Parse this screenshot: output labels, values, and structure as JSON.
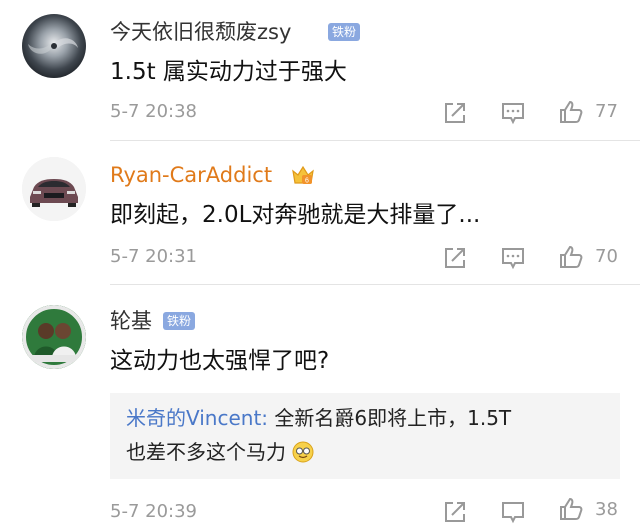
{
  "comments": [
    {
      "username": "今天依旧很颓废zsy",
      "badge": "铁粉",
      "text": "1.5t 属实动力过于强大",
      "time": "5-7 20:38",
      "likes": "77"
    },
    {
      "username": "Ryan-CarAddict",
      "text": "即刻起，2.0L对奔驰就是大排量了...",
      "time": "5-7 20:31",
      "likes": "70"
    },
    {
      "username": "轮基",
      "badge": "铁粉",
      "text": "这动力也太强悍了吧?",
      "reply": {
        "author": "米奇的Vincent:",
        "line1": " 全新名爵6即将上市，1.5T",
        "line2": "也差不多这个马力"
      },
      "time": "5-7 20:39",
      "likes": "38"
    }
  ],
  "icons": {
    "share": "share-icon",
    "comment": "comment-icon",
    "like": "thumbs-up-icon",
    "vip": "vip-crown-icon",
    "emoji": "grin-emoji-icon"
  },
  "colors": {
    "vip_name": "#e07a1a",
    "badge_bg": "#8aa8e0",
    "reply_author": "#4a78c8",
    "meta": "#9a9a9a"
  }
}
